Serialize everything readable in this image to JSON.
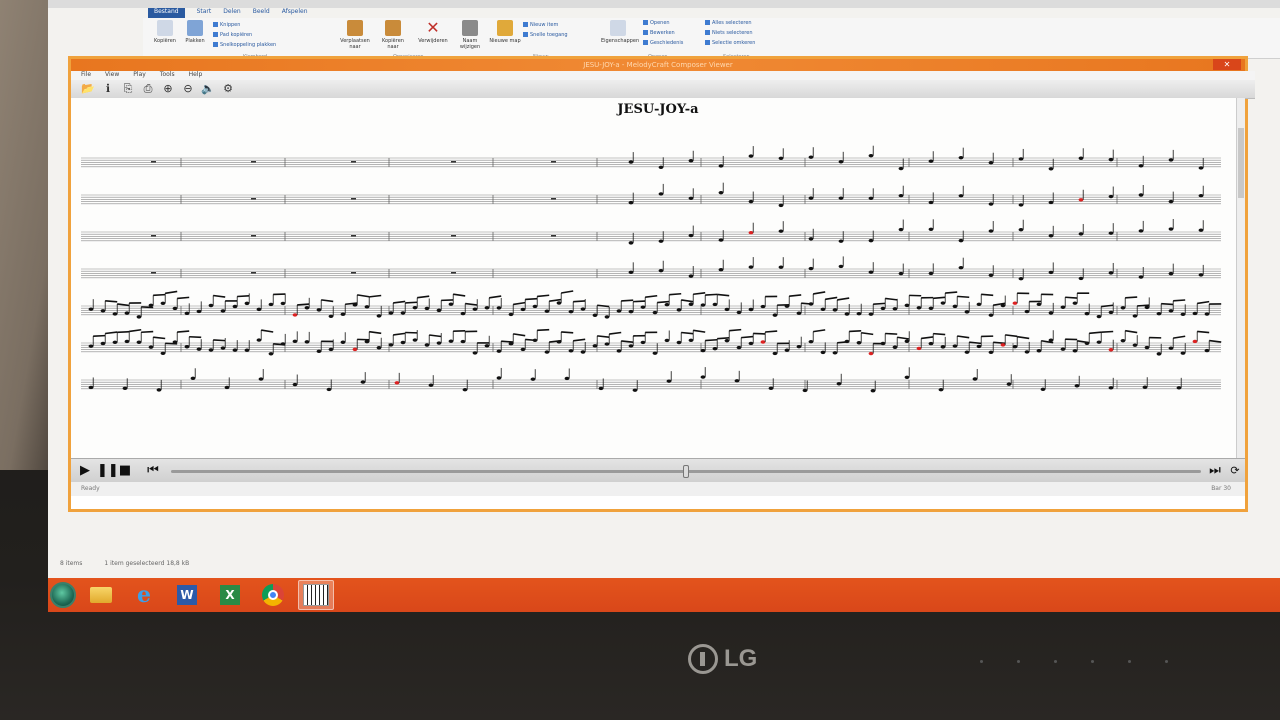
{
  "monitor": {
    "brand": "LG"
  },
  "explorer": {
    "ribbon_tabs": [
      "Bestand",
      "Start",
      "Delen",
      "Beeld",
      "Afspelen"
    ],
    "buttons": [
      {
        "label": "Kopiëren",
        "icon": "copy-icon"
      },
      {
        "label": "Plakken",
        "icon": "paste-icon"
      },
      {
        "label": "Verplaatsen naar",
        "icon": "move-icon"
      },
      {
        "label": "Kopiëren naar",
        "icon": "copy-to-icon"
      },
      {
        "label": "Verwijderen",
        "icon": "delete-icon"
      },
      {
        "label": "Naam wijzigen",
        "icon": "rename-icon"
      },
      {
        "label": "Nieuwe map",
        "icon": "new-folder-icon"
      },
      {
        "label": "Eigenschappen",
        "icon": "properties-icon"
      }
    ],
    "small_items": [
      "Knippen",
      "Pad kopiëren",
      "Snelkoppeling plakken",
      "Nieuw item",
      "Snelle toegang",
      "Openen",
      "Bewerken",
      "Geschiedenis",
      "Alles selecteren",
      "Niets selecteren",
      "Selectie omkeren"
    ],
    "group_labels": [
      "Klembord",
      "Organiseren",
      "Nieuw",
      "Openen",
      "Selecteren"
    ],
    "status_items": "8 items",
    "status_selected": "1 item geselecteerd  18,8 kB"
  },
  "app": {
    "title": "JESU-JOY-a - MelodyCraft Composer Viewer",
    "menu": [
      "File",
      "View",
      "Play",
      "Tools",
      "Help"
    ],
    "toolbar_icons": [
      "open-icon",
      "info-icon",
      "copy-icon",
      "print-icon",
      "zoom-in-icon",
      "zoom-out-icon",
      "volume-icon",
      "settings-icon"
    ],
    "score_title": "JESU-JOY-a",
    "status_left": "Ready",
    "status_right": "Bar 30",
    "playback_position": 0.5,
    "staff_count": 7
  },
  "taskbar": {
    "items": [
      "file-explorer",
      "internet-explorer",
      "word",
      "excel",
      "chrome",
      "music-app"
    ],
    "active": "music-app"
  },
  "colors": {
    "taskbar": "#d9471a",
    "window_border": "#f0a23c",
    "title_bar": "#e8761f"
  }
}
